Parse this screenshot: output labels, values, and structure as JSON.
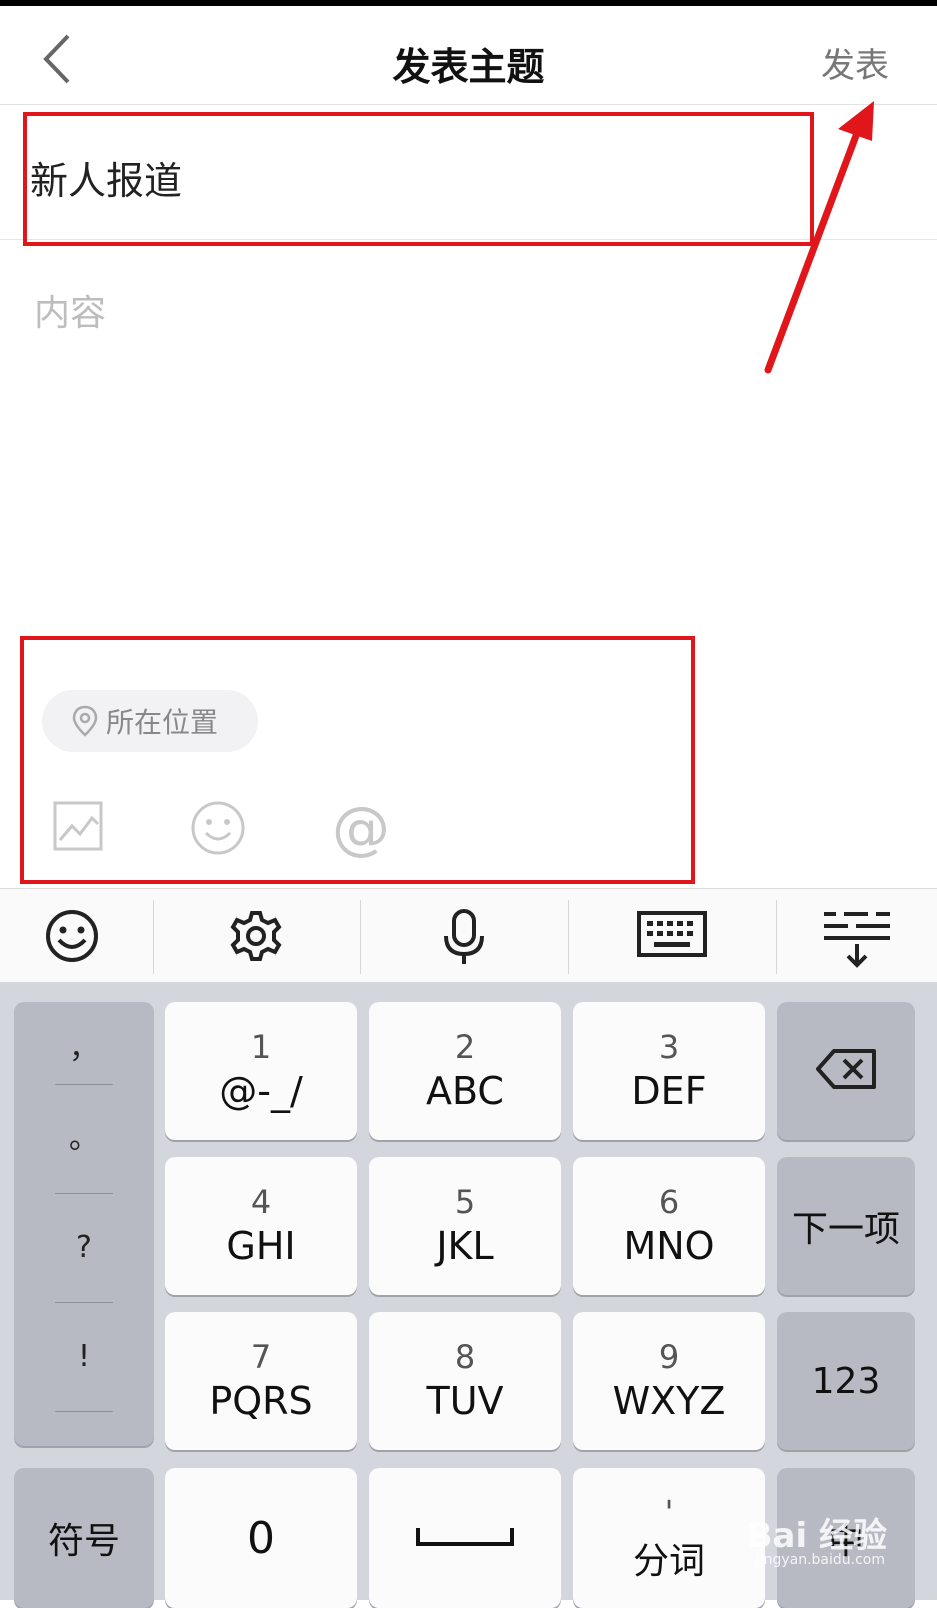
{
  "header": {
    "title": "发表主题",
    "publish_label": "发表",
    "back_icon": "chevron-left-icon"
  },
  "form": {
    "subject_value": "新人报道",
    "content_placeholder": "内容"
  },
  "attachments": {
    "location_label": "所在位置",
    "icons": [
      "image-icon",
      "smiley-icon",
      "at-icon"
    ]
  },
  "keyboard": {
    "toolbar_icons": [
      "emoji-icon",
      "settings-icon",
      "microphone-icon",
      "keyboard-icon",
      "hide-keyboard-icon"
    ],
    "punctuation": [
      "，",
      "。",
      "?",
      "!"
    ],
    "keys": [
      {
        "num": "1",
        "letters": "@-_/"
      },
      {
        "num": "2",
        "letters": "ABC"
      },
      {
        "num": "3",
        "letters": "DEF"
      },
      {
        "num": "4",
        "letters": "GHI"
      },
      {
        "num": "5",
        "letters": "JKL"
      },
      {
        "num": "6",
        "letters": "MNO"
      },
      {
        "num": "7",
        "letters": "PQRS"
      },
      {
        "num": "8",
        "letters": "TUV"
      },
      {
        "num": "9",
        "letters": "WXYZ"
      }
    ],
    "next_label": "下一项",
    "num_mode_label": "123",
    "symbols_label": "符号",
    "zero_label": "0",
    "split_label": "分词",
    "split_mark": "'",
    "lang_label": "中"
  },
  "watermark": {
    "brand": "Bai 经验",
    "url": "jingyan.baidu.com"
  },
  "colors": {
    "annotation_red": "#e0161b",
    "keyboard_bg": "#d4d6dd"
  }
}
